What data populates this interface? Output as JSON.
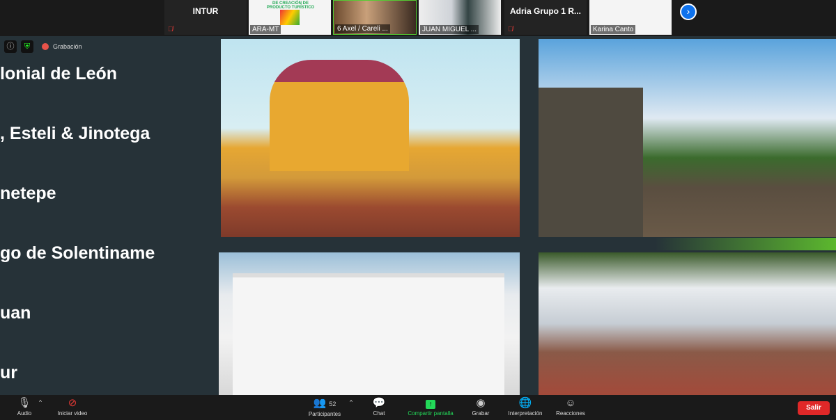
{
  "participants_strip": [
    {
      "name": "INTUR",
      "label": "",
      "muted": true
    },
    {
      "name": "",
      "label": "ARA-MT",
      "muted": true,
      "shows": "PRODUCTO TURÍSTICO"
    },
    {
      "name": "",
      "label": "6 Axel / Careli ...",
      "muted": false
    },
    {
      "name": "",
      "label": "JUAN MIGUEL ...",
      "muted": false
    },
    {
      "name": "Adria Grupo 1 R...",
      "label": "",
      "muted": true
    },
    {
      "name": "",
      "label": "Karina Canto",
      "muted": true
    }
  ],
  "strip_banner_text": "DE CREACIÓN DE PRODUCTO TURÍSTICO",
  "status": {
    "recording_label": "Grabación"
  },
  "slide": {
    "items": [
      "lonial de León",
      ", Esteli & Jinotega",
      "netepe",
      "go de Solentiname",
      "uan",
      "ur"
    ]
  },
  "toolbar": {
    "audio": "Audio",
    "video": "Iniciar video",
    "participants": "Participantes",
    "participants_count": "52",
    "chat": "Chat",
    "share": "Compartir pantalla",
    "record": "Grabar",
    "interpretation": "Interpretación",
    "reactions": "Reacciones",
    "leave": "Salir"
  },
  "colors": {
    "share_accent": "#23d959",
    "leave": "#e02828",
    "slide_bg": "#263238"
  }
}
